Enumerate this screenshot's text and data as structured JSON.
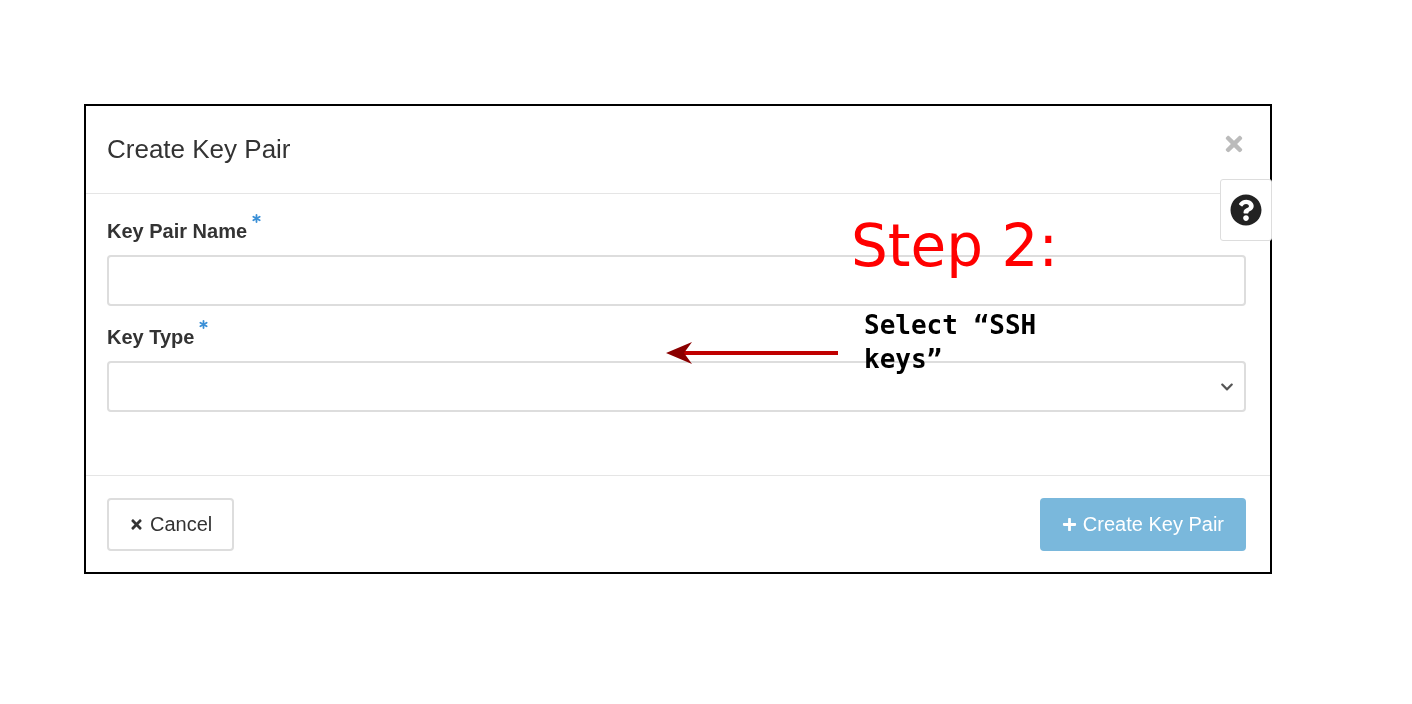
{
  "dialog": {
    "title": "Create Key Pair",
    "fields": [
      {
        "kind": "text",
        "label": "Key Pair Name",
        "required": true
      },
      {
        "kind": "select",
        "label": "Key Type",
        "required": true
      }
    ],
    "buttons": [
      {
        "kind": "cancel",
        "label": "Cancel",
        "disabled": false
      },
      {
        "kind": "primary",
        "label": "Create Key Pair",
        "disabled": true
      }
    ]
  },
  "annotation": {
    "step": "Step 2:",
    "note": "Select “SSH keys”"
  }
}
